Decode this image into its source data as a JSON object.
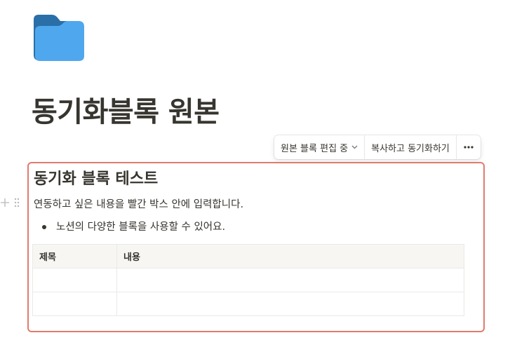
{
  "page": {
    "icon": "folder-icon",
    "title": "동기화블록 원본"
  },
  "sync_toolbar": {
    "edit_mode_label": "원본 블록 편집 중",
    "copy_sync_label": "복사하고 동기화하기",
    "more_icon": "more-horizontal-icon"
  },
  "block_handles": {
    "add_icon": "plus-icon",
    "drag_icon": "drag-handle-icon"
  },
  "synced_block": {
    "border_color": "#e07b6c",
    "heading": "동기화 블록 테스트",
    "paragraph": "연동하고 싶은 내용을 빨간 박스 안에 입력합니다.",
    "bullet": "노션의 다양한 블록을 사용할 수 있어요.",
    "table": {
      "headers": [
        "제목",
        "내용"
      ],
      "rows": [
        [
          "",
          ""
        ],
        [
          "",
          ""
        ]
      ]
    }
  },
  "colors": {
    "folder_back": "#2a6fa8",
    "folder_front": "#4fa7ee",
    "text": "#37352f"
  }
}
